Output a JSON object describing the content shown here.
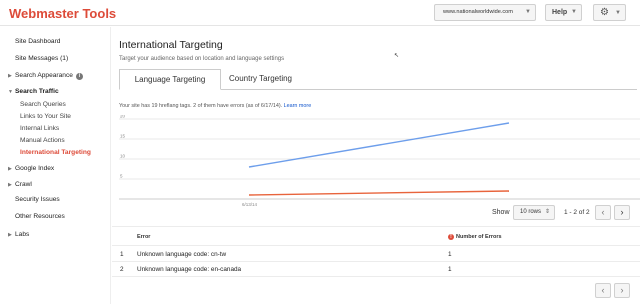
{
  "header": {
    "logo": "Webmaster Tools",
    "site": "www.nationalworldwide.com",
    "help": "Help"
  },
  "sidebar": {
    "items": [
      {
        "label": "Site Dashboard"
      },
      {
        "label": "Site Messages (1)"
      },
      {
        "label": "Search Appearance"
      },
      {
        "label": "Search Traffic"
      },
      {
        "label": "Search Queries"
      },
      {
        "label": "Links to Your Site"
      },
      {
        "label": "Internal Links"
      },
      {
        "label": "Manual Actions"
      },
      {
        "label": "International Targeting"
      },
      {
        "label": "Google Index"
      },
      {
        "label": "Crawl"
      },
      {
        "label": "Security Issues"
      },
      {
        "label": "Other Resources"
      },
      {
        "label": "Labs"
      }
    ],
    "info_glyph": "i"
  },
  "main": {
    "title": "International Targeting",
    "subtitle": "Target your audience based on location and language settings",
    "tabs": [
      {
        "label": "Language Targeting",
        "active": true
      },
      {
        "label": "Country Targeting",
        "active": false
      }
    ],
    "notice": "Your site has 19 hreflang tags. 2 of them have errors (as of 6/17/14).",
    "learn_more": "Learn more"
  },
  "chart_data": {
    "type": "line",
    "x": [
      "6/13/14",
      "6/17/14"
    ],
    "x_tick_labels": [
      "6/13/14"
    ],
    "y_tick_labels": [
      "20",
      "15",
      "10",
      "5"
    ],
    "ylim": [
      0,
      20
    ],
    "grid": true,
    "series": [
      {
        "values": [
          8,
          19
        ],
        "color": "#6d9eeb"
      },
      {
        "values": [
          1,
          2
        ],
        "color": "#e8643c"
      }
    ]
  },
  "pagination": {
    "show_label": "Show",
    "rows": "10 rows",
    "range": "1 - 2 of 2"
  },
  "table": {
    "headers": {
      "error": "Error",
      "count": "Number of Errors"
    },
    "rows": [
      {
        "index": "1",
        "error": "Unknown language code: cn-tw",
        "count": "1"
      },
      {
        "index": "2",
        "error": "Unknown language code: en-canada",
        "count": "1"
      }
    ],
    "error_glyph": "!"
  },
  "colors": {
    "brand": "#dd4b39",
    "link": "#1155cc"
  }
}
